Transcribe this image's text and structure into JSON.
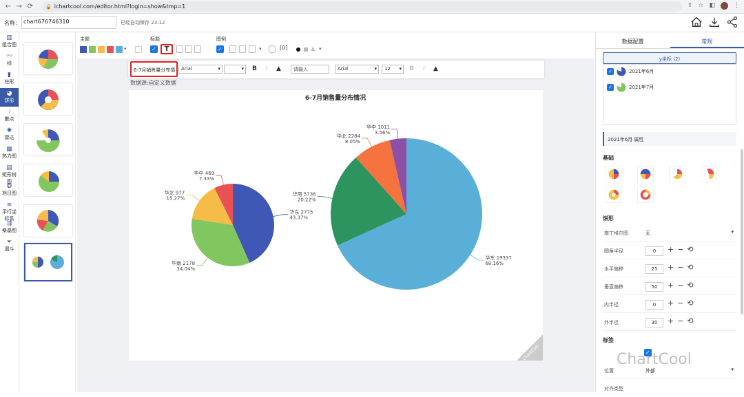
{
  "browser": {
    "url": "ichartcool.com/editor.html?login=show&tmp=1"
  },
  "appbar": {
    "name_label": "名称:",
    "name_value": "chart676746310",
    "saved": "已经自动保存 23:12"
  },
  "leftnav": [
    {
      "label": "组合图",
      "icon": "combo-icon"
    },
    {
      "label": "线",
      "icon": "line-icon"
    },
    {
      "label": "柱形",
      "icon": "bar-icon"
    },
    {
      "label": "饼形",
      "icon": "pie-icon",
      "active": true
    },
    {
      "label": "散点",
      "icon": "scatter-icon"
    },
    {
      "label": "雷达",
      "icon": "radar-icon"
    },
    {
      "label": "热力图",
      "icon": "heatmap-icon"
    },
    {
      "label": "矩形树图",
      "icon": "treemap-icon"
    },
    {
      "label": "旭日图",
      "icon": "sunburst-icon"
    },
    {
      "label": "平行坐标系",
      "icon": "parallel-icon"
    },
    {
      "label": "桑基图",
      "icon": "sankey-icon"
    },
    {
      "label": "漏斗",
      "icon": "funnel-icon"
    }
  ],
  "toolbar": {
    "theme_label": "主题",
    "title_label": "标题",
    "legend_label": "图例",
    "theme_colors": [
      "#3f57b5",
      "#81c65e",
      "#f5bd47",
      "#e85257",
      "#5aafd8"
    ]
  },
  "editor": {
    "title_text": "6-7月销售量分布情",
    "font1": "Arial",
    "subtitle_placeholder": "请输入",
    "font2": "Arial",
    "size2": "12"
  },
  "source_text": "数据源:自定义数据",
  "chart_data": {
    "type": "pie",
    "title": "6-7月销售量分布情况",
    "series": [
      {
        "name": "2021年6月",
        "slices": [
          {
            "label": "华东",
            "value": 2775,
            "percent": "43.37%",
            "color": "#3f57b5"
          },
          {
            "label": "华南",
            "value": 2178,
            "percent": "34.04%",
            "color": "#81c65e"
          },
          {
            "label": "华北",
            "value": 977,
            "percent": "15.27%",
            "color": "#f5bd47"
          },
          {
            "label": "华中",
            "value": 469,
            "percent": "7.33%",
            "color": "#e85257"
          }
        ]
      },
      {
        "name": "2021年7月",
        "slices": [
          {
            "label": "华东",
            "value": 19337,
            "percent": "68.16%",
            "color": "#5aafd8"
          },
          {
            "label": "华南",
            "value": 5736,
            "percent": "20.22%",
            "color": "#2d9460"
          },
          {
            "label": "华北",
            "value": 2284,
            "percent": "8.05%",
            "color": "#f4733e"
          },
          {
            "label": "华中",
            "value": 1011,
            "percent": "3.56%",
            "color": "#8e4fa6"
          }
        ]
      }
    ]
  },
  "watermark": "ChartCool",
  "rpanel": {
    "tab1": "数据配置",
    "tab2": "常规",
    "yaxis": "y坐标 (2)",
    "series": [
      "2021年6月",
      "2021年7月"
    ],
    "prop_title": "2021年6月 属性",
    "basic": "基础",
    "pie": "饼形",
    "rows": [
      {
        "label": "南丁格尔图",
        "value": "无",
        "select": true
      },
      {
        "label": "圆角半径",
        "value": "0"
      },
      {
        "label": "水平偏移",
        "value": "25"
      },
      {
        "label": "垂直偏移",
        "value": "50"
      },
      {
        "label": "内半径",
        "value": "0"
      },
      {
        "label": "外半径",
        "value": "30"
      }
    ],
    "label_sec": "标签",
    "pos_label": "位置",
    "pos_value": "外部",
    "align_label": "对齐类型"
  }
}
